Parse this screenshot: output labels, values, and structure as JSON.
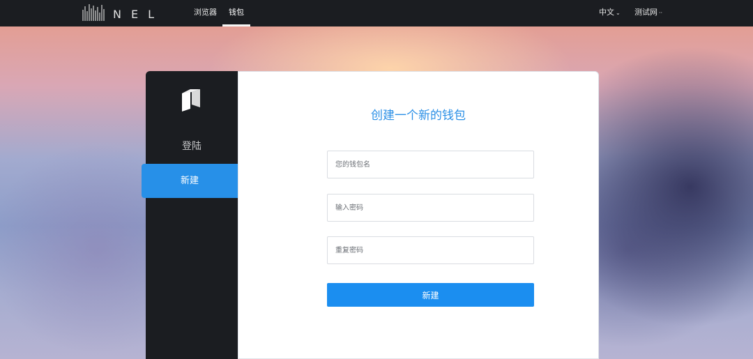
{
  "header": {
    "logo_text": "NEL",
    "nav": [
      {
        "label": "浏览器"
      },
      {
        "label": "钱包"
      }
    ],
    "language": "中文",
    "network": "测试网"
  },
  "sidebar": {
    "items": [
      {
        "label": "登陆"
      },
      {
        "label": "新建"
      }
    ]
  },
  "form": {
    "title": "创建一个新的钱包",
    "wallet_name_placeholder": "您的钱包名",
    "password_placeholder": "输入密码",
    "confirm_password_placeholder": "重复密码",
    "submit_label": "新建"
  },
  "colors": {
    "accent": "#1b8ef0",
    "dark": "#1b1d21"
  }
}
